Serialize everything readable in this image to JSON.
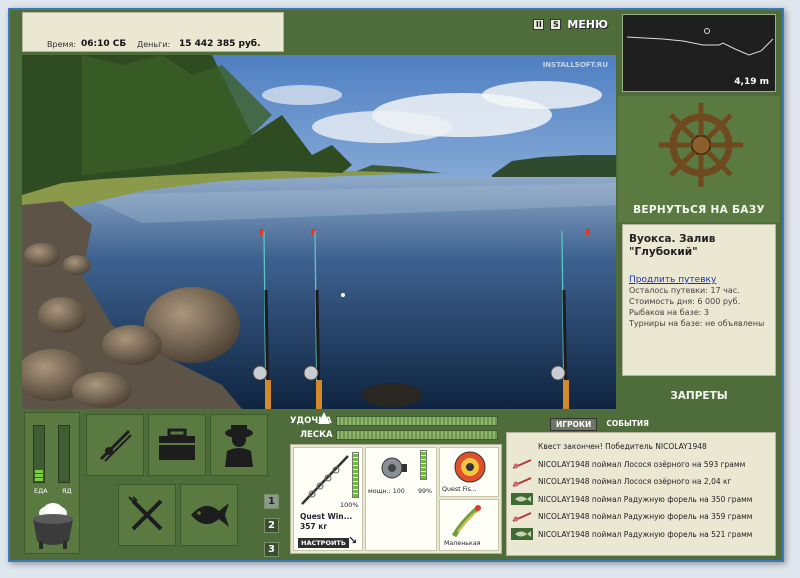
{
  "status": {
    "time_label": "Время:",
    "time_value": "06:10 СБ",
    "money_label": "Деньги:",
    "money_value": "15 442 385 руб."
  },
  "toolbar": {
    "pause_label": "II",
    "sound_label": "S",
    "menu_label": "МЕНЮ"
  },
  "watermark": "INSTALLSOFT.RU",
  "depth": {
    "value": "4,19 m"
  },
  "navigation": {
    "back_to_base_label": "ВЕРНУТЬСЯ НА БАЗУ",
    "bans_label": "ЗАПРЕТЫ"
  },
  "location": {
    "name_line1": "Вуокса. Залив",
    "name_line2": "\"Глубокий\"",
    "extend_link": "Продлить путевку",
    "remaining": "Осталось путевки: 17 час.",
    "day_cost": "Стоимость дня: 6 000 руб.",
    "fishermen": "Рыбаков на базе: 3",
    "tournaments": "Турниры на базе: не объявлены"
  },
  "needs": {
    "food_label": "ЕДА",
    "poison_label": "ЯД",
    "food_level": 0.2,
    "poison_level": 0.0
  },
  "rod_slots": [
    "1",
    "2",
    "3"
  ],
  "tackle": {
    "rod_label": "УДОЧКА",
    "line_label": "ЛЕСКА",
    "rod_name": "Quest Win...",
    "rod_weight": "357 кг",
    "rod_percent": "100%",
    "setup_button": "НАСТРОИТЬ",
    "reel_info": "мощн.: 100",
    "reel_percent": "99%",
    "lure_name": "Quest Fis...",
    "bait_name": "Маленькая"
  },
  "log": {
    "tabs": [
      "ИГРОКИ",
      "СОБЫТИЯ"
    ],
    "entries": [
      {
        "icon": "quest-icon",
        "text": "Квест закончен! Победитель NICOLAY1948"
      },
      {
        "icon": "rod-catch-icon",
        "text": "NICOLAY1948 поймал Лосося озёрного на 593 грамм"
      },
      {
        "icon": "rod-catch-icon",
        "text": "NICOLAY1948 поймал Лосося озёрного на 2,04 кг"
      },
      {
        "icon": "fish-catch-icon",
        "text": "NICOLAY1948 поймал Радужную форель на 350 грамм"
      },
      {
        "icon": "rod-catch-icon",
        "text": "NICOLAY1948 поймал Радужную форель на 359 грамм"
      },
      {
        "icon": "fish-catch-icon",
        "text": "NICOLAY1948 поймал Радужную форель на 521 грамм"
      }
    ]
  },
  "colors": {
    "panel_green": "#4f6d3b",
    "cream": "#eae7d3",
    "link_blue": "#1a35a8",
    "meter_green": "#7ad042"
  }
}
